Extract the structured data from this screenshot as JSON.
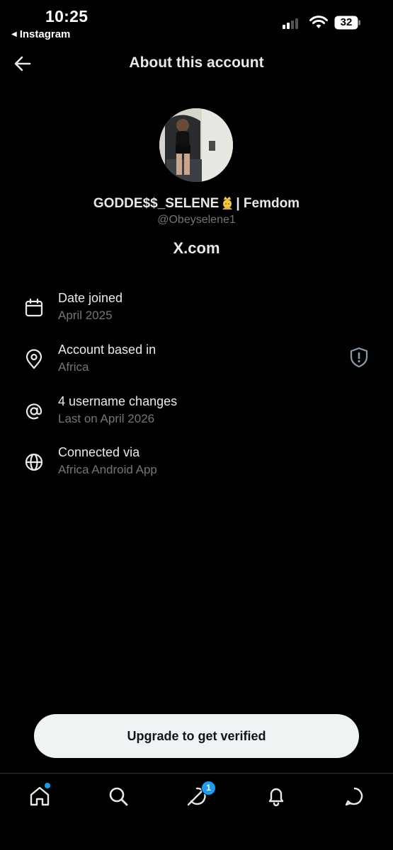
{
  "status_bar": {
    "time": "10:25",
    "back_app": "Instagram",
    "battery": "32"
  },
  "header": {
    "title": "About this account"
  },
  "profile": {
    "display_name_prefix": "GODDE$$_SELENE",
    "display_name_suffix": "| Femdom",
    "handle": "@Obeyselene1",
    "site": "X.com"
  },
  "rows": [
    {
      "title": "Date joined",
      "value": "April 2025",
      "icon": "calendar-icon"
    },
    {
      "title": "Account based in",
      "value": "Africa",
      "icon": "location-pin-icon"
    },
    {
      "title": "4 username changes",
      "value": "Last on April 2026",
      "icon": "at-sign-icon"
    },
    {
      "title": "Connected via",
      "value": "Africa Android App",
      "icon": "globe-icon"
    }
  ],
  "upgrade_label": "Upgrade to get verified",
  "tabbar": {
    "messages_badge": "1"
  },
  "colors": {
    "background": "#000000",
    "text": "#e7e9ea",
    "muted": "#71767b",
    "accent": "#1d9bf0",
    "button_bg": "#eff3f4"
  }
}
